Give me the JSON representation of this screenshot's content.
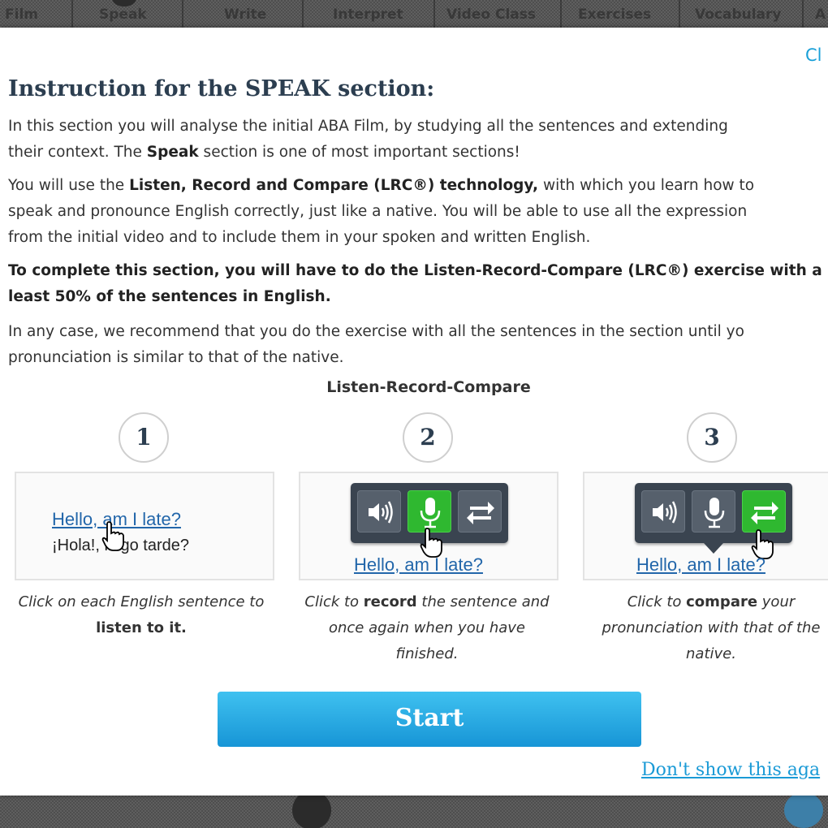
{
  "nav": {
    "items": [
      "Film",
      "Speak",
      "Write",
      "Interpret",
      "Video Class",
      "Exercises",
      "Vocabulary",
      "A"
    ]
  },
  "modal": {
    "close_label": "Cl",
    "title": "Instruction for the SPEAK section:",
    "p1": {
      "line1": "In this section you will analyse the initial ABA Film, by studying all the sentences and extending",
      "line2_pre": "their context. The ",
      "line2_bold": "Speak",
      "line2_post": " section is one of most important sections!"
    },
    "p2": {
      "line1_pre": "You will use the ",
      "line1_bold": "Listen, Record and Compare (LRC®) technology,",
      "line1_post": " with which you learn how to",
      "line2": "speak and pronounce English correctly, just like a native. You will be able to use all the expression",
      "line3": "from the initial video and to include them in your spoken and written English."
    },
    "p3": {
      "line1": "To complete this section, you will have to do the Listen-Record-Compare (LRC®) exercise with a",
      "line2": "least 50% of the sentences in English."
    },
    "p4": {
      "line1": "In any case, we recommend that you do the exercise with all the sentences in the section until yo",
      "line2": "pronunciation is similar to that of the native."
    },
    "lrc_heading": "Listen-Record-Compare",
    "steps": [
      {
        "number": "1",
        "sentence": "Hello, am I late?",
        "translation": "¡Hola!, llego tarde?",
        "caption_l1": "Click on each English sentence to",
        "caption_l2": "listen to it."
      },
      {
        "number": "2",
        "sentence": "Hello, am I late?",
        "caption_pre": "Click to ",
        "caption_bold": "record",
        "caption_post": " the sentence and",
        "caption_l2": "once again when you have",
        "caption_l3": "finished."
      },
      {
        "number": "3",
        "sentence": "Hello, am I late?",
        "caption_pre": "Click to ",
        "caption_bold": "compare",
        "caption_post": " your",
        "caption_l2": "pronunciation with that of the",
        "caption_l3": "native."
      }
    ],
    "start_label": "Start",
    "dont_show_label": "Don't show this aga"
  },
  "colors": {
    "accent": "#1aa0d8",
    "button_top": "#3fc1f0",
    "button_bottom": "#1795d6",
    "active_tool": "#2fb830",
    "toolbar": "#3a4450",
    "title": "#2c3e50"
  },
  "icons": [
    "speaker-icon",
    "microphone-icon",
    "compare-arrows-icon",
    "hand-cursor-icon"
  ]
}
